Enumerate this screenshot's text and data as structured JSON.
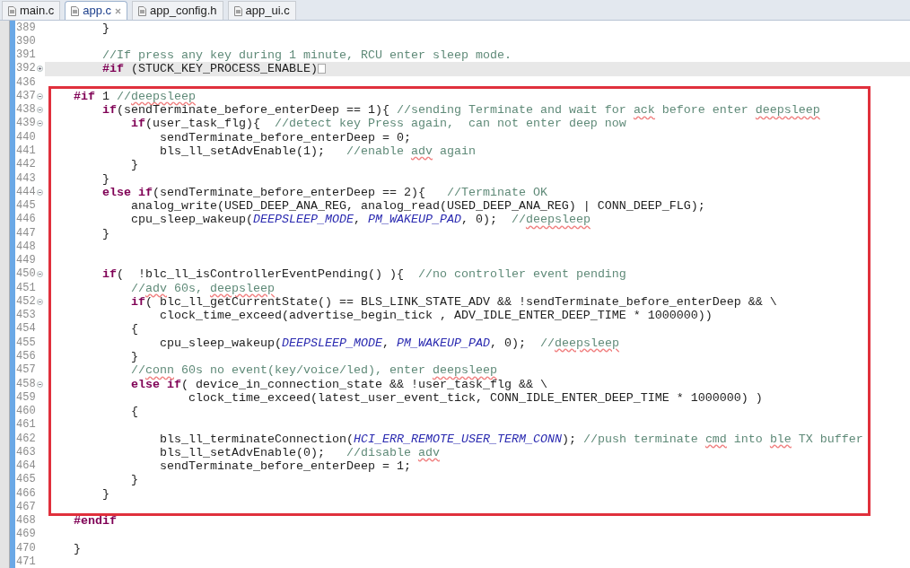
{
  "tabs": [
    {
      "label": "main.c",
      "selected": false
    },
    {
      "label": "app.c",
      "selected": true
    },
    {
      "label": "app_config.h",
      "selected": false
    },
    {
      "label": "app_ui.c",
      "selected": false
    }
  ],
  "editor": {
    "sections": [
      {
        "boxed": false,
        "lines": [
          {
            "number": "389",
            "current": false,
            "code": [
              {
                "kind": "plain",
                "text": "        }"
              }
            ]
          },
          {
            "number": "390",
            "current": false
          },
          {
            "number": "391",
            "current": false,
            "code": [
              {
                "kind": "comment",
                "text": "        //If press any key during 1 minute, RCU enter sleep mode."
              }
            ]
          },
          {
            "number": "392",
            "current": true,
            "folded": true,
            "code": [
              {
                "kind": "keyword",
                "text": "        #if"
              },
              {
                "kind": "plain",
                "text": " (STUCK_KEY_PROCESS_ENABLE)"
              }
            ]
          },
          {
            "number": "436",
            "current": false
          }
        ]
      },
      {
        "boxed": true,
        "lines": [
          {
            "number": "437",
            "current": false,
            "folded": false,
            "code": [
              {
                "kind": "keyword",
                "text": "    #if"
              },
              {
                "kind": "plain",
                "text": " 1 "
              },
              {
                "kind": "comment",
                "text": "//"
              },
              {
                "kind": "misspelled",
                "text": "deepsleep"
              }
            ]
          },
          {
            "number": "438",
            "current": false,
            "folded": false,
            "code": [
              {
                "kind": "keyword",
                "text": "        if"
              },
              {
                "kind": "plain",
                "text": "(sendTerminate_before_enterDeep == 1){ "
              },
              {
                "kind": "comment",
                "text": "//sending Terminate and wait for "
              },
              {
                "kind": "misspelled",
                "text": "ack"
              },
              {
                "kind": "comment",
                "text": " before enter "
              },
              {
                "kind": "misspelled",
                "text": "deepsleep"
              }
            ]
          },
          {
            "number": "439",
            "current": false,
            "folded": false,
            "code": [
              {
                "kind": "keyword",
                "text": "            if"
              },
              {
                "kind": "plain",
                "text": "(user_task_flg){  "
              },
              {
                "kind": "comment",
                "text": "//detect key Press again,  can not enter deep now"
              }
            ]
          },
          {
            "number": "440",
            "current": false,
            "code": [
              {
                "kind": "plain",
                "text": "                sendTerminate_before_enterDeep = 0;"
              }
            ]
          },
          {
            "number": "441",
            "current": false,
            "code": [
              {
                "kind": "plain",
                "text": "                bls_ll_setAdvEnable(1);   "
              },
              {
                "kind": "comment",
                "text": "//enable "
              },
              {
                "kind": "misspelled",
                "text": "adv"
              },
              {
                "kind": "comment",
                "text": " again"
              }
            ]
          },
          {
            "number": "442",
            "current": false,
            "code": [
              {
                "kind": "plain",
                "text": "            }"
              }
            ]
          },
          {
            "number": "443",
            "current": false,
            "code": [
              {
                "kind": "plain",
                "text": "        }"
              }
            ]
          },
          {
            "number": "444",
            "current": false,
            "folded": false,
            "code": [
              {
                "kind": "keyword",
                "text": "        else if"
              },
              {
                "kind": "plain",
                "text": "(sendTerminate_before_enterDeep == 2){   "
              },
              {
                "kind": "comment",
                "text": "//Terminate OK"
              }
            ]
          },
          {
            "number": "445",
            "current": false,
            "code": [
              {
                "kind": "plain",
                "text": "            analog_write(USED_DEEP_ANA_REG, analog_read(USED_DEEP_ANA_REG) | CONN_DEEP_FLG);"
              }
            ]
          },
          {
            "number": "446",
            "current": false,
            "code": [
              {
                "kind": "plain",
                "text": "            cpu_sleep_wakeup("
              },
              {
                "kind": "macro",
                "text": "DEEPSLEEP_MODE"
              },
              {
                "kind": "plain",
                "text": ", "
              },
              {
                "kind": "macro",
                "text": "PM_WAKEUP_PAD"
              },
              {
                "kind": "plain",
                "text": ", 0);  "
              },
              {
                "kind": "comment",
                "text": "//"
              },
              {
                "kind": "misspelled",
                "text": "deepsleep"
              }
            ]
          },
          {
            "number": "447",
            "current": false,
            "code": [
              {
                "kind": "plain",
                "text": "        }"
              }
            ]
          },
          {
            "number": "448",
            "current": false
          },
          {
            "number": "449",
            "current": false
          },
          {
            "number": "450",
            "current": false,
            "folded": false,
            "code": [
              {
                "kind": "keyword",
                "text": "        if"
              },
              {
                "kind": "plain",
                "text": "(  !blc_ll_isControllerEventPending() ){  "
              },
              {
                "kind": "comment",
                "text": "//no controller event pending"
              }
            ]
          },
          {
            "number": "451",
            "current": false,
            "code": [
              {
                "kind": "comment",
                "text": "            //"
              },
              {
                "kind": "misspelled",
                "text": "adv"
              },
              {
                "kind": "comment",
                "text": " 60s, "
              },
              {
                "kind": "misspelled",
                "text": "deepsleep"
              }
            ]
          },
          {
            "number": "452",
            "current": false,
            "folded": false,
            "code": [
              {
                "kind": "keyword",
                "text": "            if"
              },
              {
                "kind": "plain",
                "text": "( blc_ll_getCurrentState() == BLS_LINK_STATE_ADV && !sendTerminate_before_enterDeep && \\"
              }
            ]
          },
          {
            "number": "453",
            "current": false,
            "code": [
              {
                "kind": "plain",
                "text": "                clock_time_exceed(advertise_begin_tick , ADV_IDLE_ENTER_DEEP_TIME * 1000000))"
              }
            ]
          },
          {
            "number": "454",
            "current": false,
            "code": [
              {
                "kind": "plain",
                "text": "            {"
              }
            ]
          },
          {
            "number": "455",
            "current": false,
            "code": [
              {
                "kind": "plain",
                "text": "                cpu_sleep_wakeup("
              },
              {
                "kind": "macro",
                "text": "DEEPSLEEP_MODE"
              },
              {
                "kind": "plain",
                "text": ", "
              },
              {
                "kind": "macro",
                "text": "PM_WAKEUP_PAD"
              },
              {
                "kind": "plain",
                "text": ", 0);  "
              },
              {
                "kind": "comment",
                "text": "//"
              },
              {
                "kind": "misspelled",
                "text": "deepsleep"
              }
            ]
          },
          {
            "number": "456",
            "current": false,
            "code": [
              {
                "kind": "plain",
                "text": "            }"
              }
            ]
          },
          {
            "number": "457",
            "current": false,
            "code": [
              {
                "kind": "comment",
                "text": "            //"
              },
              {
                "kind": "misspelled",
                "text": "conn"
              },
              {
                "kind": "comment",
                "text": " 60s no event(key/voice/led), enter "
              },
              {
                "kind": "misspelled",
                "text": "deepsleep"
              }
            ]
          },
          {
            "number": "458",
            "current": false,
            "folded": false,
            "code": [
              {
                "kind": "keyword",
                "text": "            else if"
              },
              {
                "kind": "plain",
                "text": "( device_in_connection_state && !user_task_flg && \\"
              }
            ]
          },
          {
            "number": "459",
            "current": false,
            "code": [
              {
                "kind": "plain",
                "text": "                    clock_time_exceed(latest_user_event_tick, CONN_IDLE_ENTER_DEEP_TIME * 1000000) )"
              }
            ]
          },
          {
            "number": "460",
            "current": false,
            "code": [
              {
                "kind": "plain",
                "text": "            {"
              }
            ]
          },
          {
            "number": "461",
            "current": false
          },
          {
            "number": "462",
            "current": false,
            "code": [
              {
                "kind": "plain",
                "text": "                bls_ll_terminateConnection("
              },
              {
                "kind": "macro",
                "text": "HCI_ERR_REMOTE_USER_TERM_CONN"
              },
              {
                "kind": "plain",
                "text": "); "
              },
              {
                "kind": "comment",
                "text": "//push terminate "
              },
              {
                "kind": "misspelled",
                "text": "cmd"
              },
              {
                "kind": "comment",
                "text": " into "
              },
              {
                "kind": "misspelled",
                "text": "ble"
              },
              {
                "kind": "comment",
                "text": " TX buffer"
              }
            ]
          },
          {
            "number": "463",
            "current": false,
            "code": [
              {
                "kind": "plain",
                "text": "                bls_ll_setAdvEnable(0);   "
              },
              {
                "kind": "comment",
                "text": "//disable "
              },
              {
                "kind": "misspelled",
                "text": "adv"
              }
            ]
          },
          {
            "number": "464",
            "current": false,
            "code": [
              {
                "kind": "plain",
                "text": "                sendTerminate_before_enterDeep = 1;"
              }
            ]
          },
          {
            "number": "465",
            "current": false,
            "code": [
              {
                "kind": "plain",
                "text": "            }"
              }
            ]
          },
          {
            "number": "466",
            "current": false,
            "code": [
              {
                "kind": "plain",
                "text": "        }"
              }
            ]
          },
          {
            "number": "467",
            "current": false
          }
        ]
      },
      {
        "boxed": false,
        "lines": [
          {
            "number": "468",
            "current": false,
            "code": [
              {
                "kind": "keyword",
                "text": "    #endif"
              }
            ]
          },
          {
            "number": "469",
            "current": false
          },
          {
            "number": "470",
            "current": false,
            "code": [
              {
                "kind": "plain",
                "text": "    }"
              }
            ]
          },
          {
            "number": "471",
            "current": false
          }
        ]
      }
    ]
  }
}
